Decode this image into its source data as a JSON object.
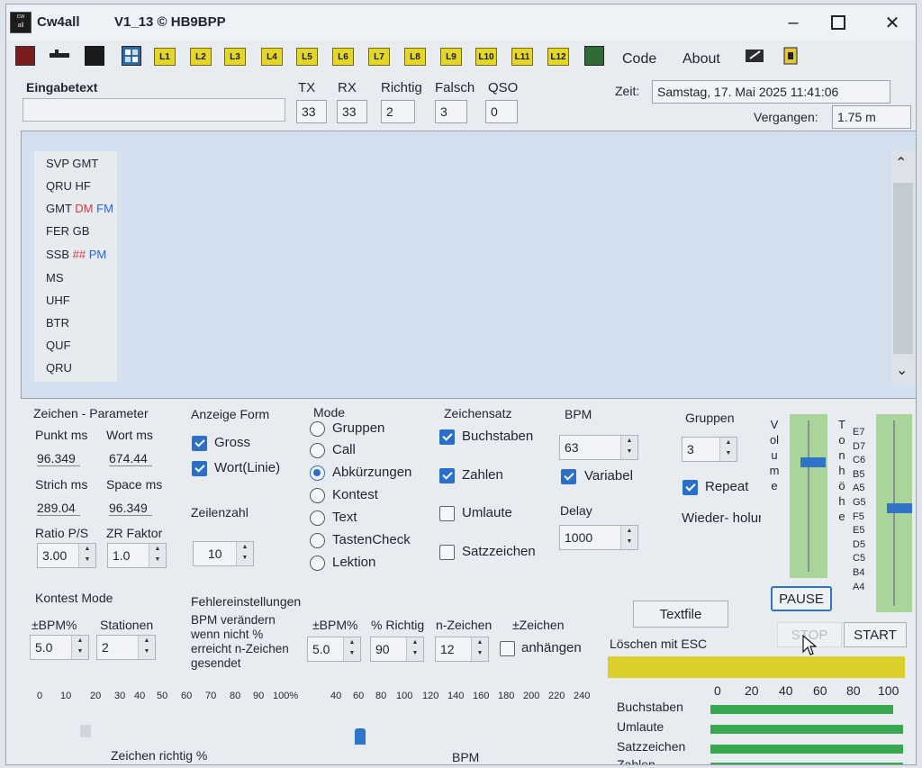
{
  "window": {
    "title": "Cw4all",
    "version": "V1_13 © HB9BPP"
  },
  "toolbar": {
    "lessons": [
      "L1",
      "L2",
      "L3",
      "L4",
      "L5",
      "L6",
      "L7",
      "L8",
      "L9",
      "L10",
      "L11",
      "L12"
    ],
    "menu": [
      "Code",
      "About"
    ]
  },
  "header": {
    "eingabetext_label": "Eingabetext",
    "eingabetext_value": "",
    "stats": [
      {
        "label": "TX",
        "value": "33"
      },
      {
        "label": "RX",
        "value": "33"
      },
      {
        "label": "Richtig",
        "value": "2"
      },
      {
        "label": "Falsch",
        "value": "3"
      },
      {
        "label": "QSO",
        "value": "0"
      }
    ],
    "zeit_label": "Zeit:",
    "zeit_value": "Samstag, 17. Mai 2025 11:41:06",
    "vergangen_label": "Vergangen:",
    "vergangen_value": "1.75 m"
  },
  "abbreviations": [
    {
      "parts": [
        {
          "t": "SVP",
          "c": "#1f2530"
        },
        {
          "t": "GMT",
          "c": "#1f2530"
        }
      ]
    },
    {
      "parts": [
        {
          "t": "QRU",
          "c": "#1f2530"
        },
        {
          "t": "HF",
          "c": "#1f2530"
        }
      ]
    },
    {
      "parts": [
        {
          "t": "GMT",
          "c": "#1f2530"
        },
        {
          "t": "DM",
          "c": "#d23b3b"
        },
        {
          "t": "FM",
          "c": "#2f63d2"
        }
      ]
    },
    {
      "parts": [
        {
          "t": "FER",
          "c": "#1f2530"
        },
        {
          "t": "GB",
          "c": "#1f2530"
        }
      ]
    },
    {
      "parts": [
        {
          "t": "SSB",
          "c": "#1f2530"
        },
        {
          "t": "##",
          "c": "#d23b3b"
        },
        {
          "t": "PM",
          "c": "#2f63d2"
        }
      ]
    },
    {
      "parts": [
        {
          "t": "MS",
          "c": "#1f2530"
        }
      ]
    },
    {
      "parts": [
        {
          "t": "UHF",
          "c": "#1f2530"
        }
      ]
    },
    {
      "parts": [
        {
          "t": "BTR",
          "c": "#1f2530"
        }
      ]
    },
    {
      "parts": [
        {
          "t": "QUF",
          "c": "#1f2530"
        }
      ]
    },
    {
      "parts": [
        {
          "t": "QRU",
          "c": "#1f2530"
        }
      ]
    }
  ],
  "zeichen_param": {
    "title": "Zeichen - Parameter",
    "punkt_label": "Punkt ms",
    "punkt_value": "96.349",
    "wort_label": "Wort ms",
    "wort_value": "674.44",
    "strich_label": "Strich ms",
    "strich_value": "289.04",
    "space_label": "Space ms",
    "space_value": "96.349",
    "ratio_label": "Ratio P/S",
    "ratio_value": "3.00",
    "zr_label": "ZR Faktor",
    "zr_value": "1.0"
  },
  "anzeige": {
    "title": "Anzeige Form",
    "gross_label": "Gross",
    "gross_checked": true,
    "wort_label": "Wort(Linie)",
    "wort_checked": true,
    "zeilenzahl_label": "Zeilenzahl",
    "zeilenzahl_value": "10"
  },
  "mode": {
    "title": "Mode",
    "options": [
      "Gruppen",
      "Call",
      "Abkürzungen",
      "Kontest",
      "Text",
      "TastenCheck",
      "Lektion"
    ],
    "selected": "Abkürzungen"
  },
  "zeichensatz": {
    "title": "Zeichensatz",
    "options": [
      {
        "label": "Buchstaben",
        "checked": true
      },
      {
        "label": "Zahlen",
        "checked": true
      },
      {
        "label": "Umlaute",
        "checked": false
      },
      {
        "label": "Satzzeichen",
        "checked": false
      }
    ]
  },
  "bpm": {
    "title": "BPM",
    "value": "63",
    "variabel_label": "Variabel",
    "variabel_checked": true,
    "delay_label": "Delay",
    "delay_value": "1000"
  },
  "gruppen": {
    "title": "Gruppen",
    "value": "3",
    "repeat_label": "Repeat",
    "repeat_checked": true,
    "wiederholung_label": "Wieder- holur"
  },
  "volume": {
    "label": "Volume",
    "level": 0.74
  },
  "tonhoehe": {
    "label": "Tonhöhe",
    "notes": [
      "E7",
      "D7",
      "C6",
      "B5",
      "A5",
      "G5",
      "F5",
      "E5",
      "D5",
      "C5",
      "B4",
      "A4"
    ],
    "level": 0.53
  },
  "controls": {
    "pause": "PAUSE",
    "stop": "STOP",
    "start": "START",
    "textfile": "Textfile",
    "loeschen": "Löschen mit ESC"
  },
  "kontest": {
    "title": "Kontest Mode",
    "bpm_label": "±BPM%",
    "bpm_value": "5.0",
    "stationen_label": "Stationen",
    "stationen_value": "2"
  },
  "fehler": {
    "title": "Fehlereinstellungen",
    "desc": [
      "BPM verändern",
      "wenn nicht %",
      "erreicht n-Zeichen",
      "gesendet"
    ],
    "bpm_label": "±BPM%",
    "bpm_value": "5.0",
    "richtig_label": "% Richtig",
    "richtig_value": "90",
    "nz_label": "n-Zeichen",
    "nz_value": "12",
    "zeichen_label": "±Zeichen",
    "anhaengen_label": "anhängen",
    "anhaengen_checked": false
  },
  "scale_left": {
    "ticks": [
      "0",
      "10",
      "20",
      "30",
      "40",
      "50",
      "60",
      "70",
      "80",
      "90",
      "100%"
    ],
    "label": "Zeichen richtig %"
  },
  "scale_bpm": {
    "ticks": [
      "40",
      "60",
      "80",
      "100",
      "120",
      "140",
      "160",
      "180",
      "200",
      "220",
      "240"
    ],
    "label": "BPM"
  },
  "stats_chart": {
    "ticks": [
      "0",
      "20",
      "40",
      "60",
      "80",
      "100"
    ],
    "rows": [
      {
        "label": "Buchstaben",
        "value": 95
      },
      {
        "label": "Umlaute",
        "value": 100
      },
      {
        "label": "Satzzeichen",
        "value": 100
      },
      {
        "label": "Zahlen",
        "value": 100
      }
    ]
  },
  "colors": {
    "accent": "#2f74c8",
    "yellow_bar": "#dccf2c",
    "green": "#37a84f",
    "text_area": "#d3e0ef"
  }
}
